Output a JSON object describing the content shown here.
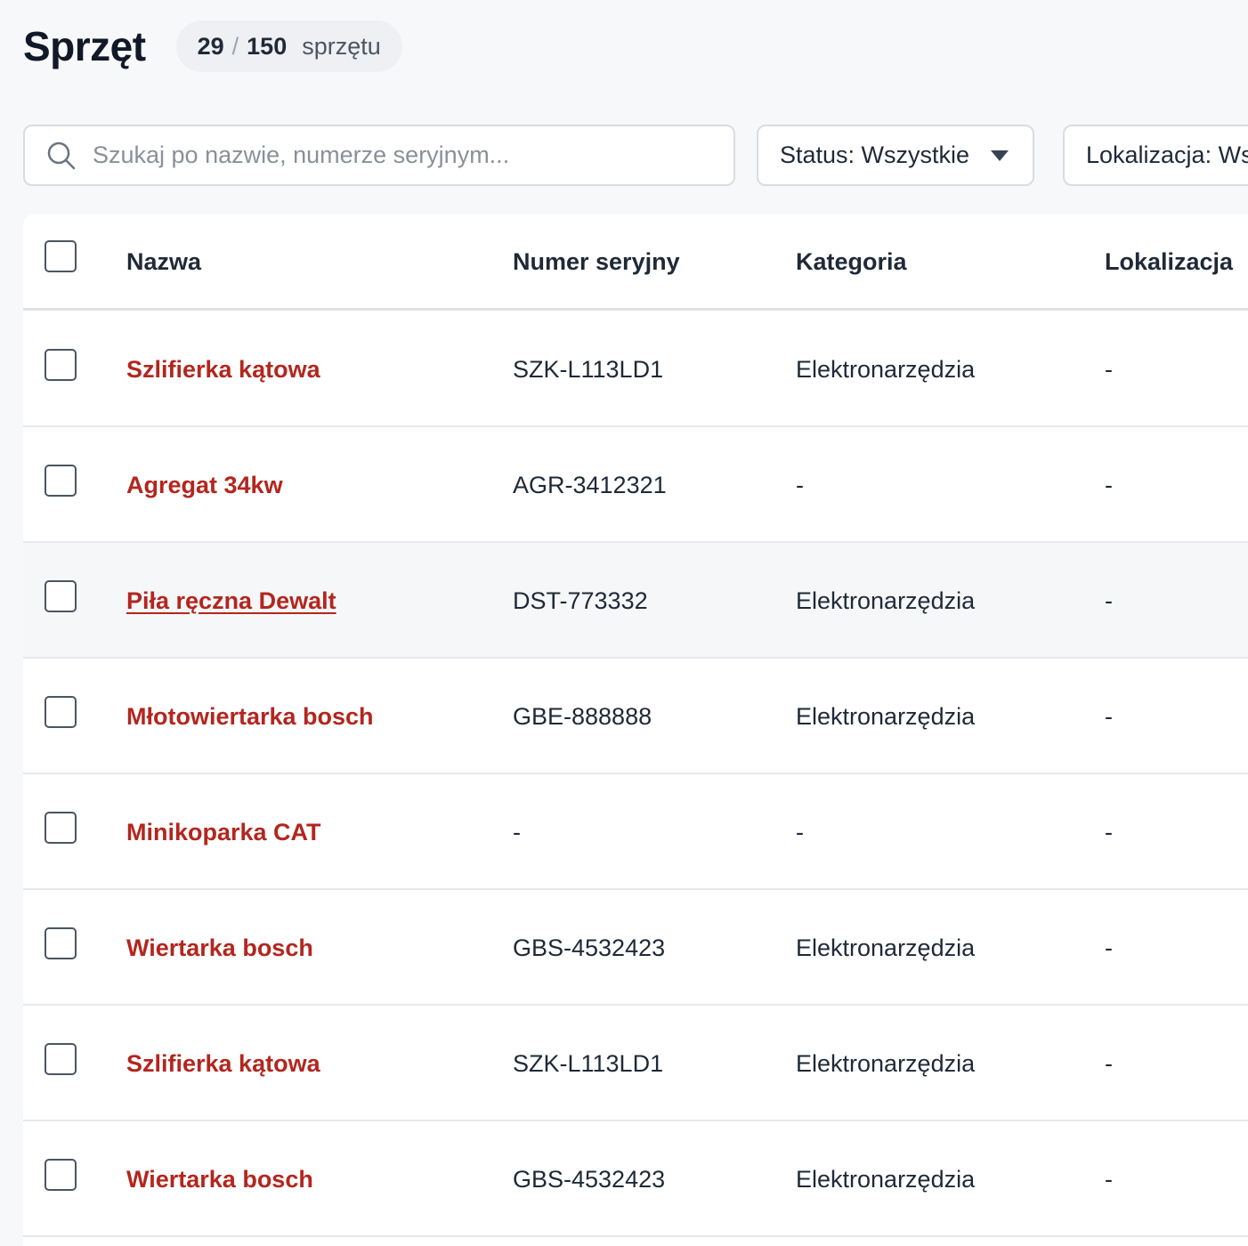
{
  "header": {
    "title": "Sprzęt",
    "count_current": "29",
    "count_separator": "/",
    "count_total": "150",
    "count_unit": "sprzętu"
  },
  "filters": {
    "search_placeholder": "Szukaj po nazwie, numerze seryjnym...",
    "search_value": "",
    "status_label": "Status: Wszystkie",
    "location_label": "Lokalizacja: Wszystkie"
  },
  "table": {
    "columns": [
      "Nazwa",
      "Numer seryjny",
      "Kategoria",
      "Lokalizacja"
    ],
    "rows": [
      {
        "name": "Szlifierka kątowa",
        "serial": "SZK-L113LD1",
        "category": "Elektronarzędzia",
        "location": "-"
      },
      {
        "name": "Agregat 34kw",
        "serial": "AGR-3412321",
        "category": "-",
        "location": "-"
      },
      {
        "name": "Piła ręczna Dewalt",
        "serial": "DST-773332",
        "category": "Elektronarzędzia",
        "location": "-"
      },
      {
        "name": "Młotowiertarka bosch",
        "serial": "GBE-888888",
        "category": "Elektronarzędzia",
        "location": "-"
      },
      {
        "name": "Minikoparka CAT",
        "serial": "-",
        "category": "-",
        "location": "-"
      },
      {
        "name": "Wiertarka bosch",
        "serial": "GBS-4532423",
        "category": "Elektronarzędzia",
        "location": "-"
      },
      {
        "name": "Szlifierka kątowa",
        "serial": "SZK-L113LD1",
        "category": "Elektronarzędzia",
        "location": "-"
      },
      {
        "name": "Wiertarka bosch",
        "serial": "GBS-4532423",
        "category": "Elektronarzędzia",
        "location": "-"
      }
    ]
  },
  "colors": {
    "accent": "#b3261e",
    "background": "#f7f8fa",
    "border": "#d9dce1"
  },
  "icons": {
    "search": "search-icon",
    "dropdown": "caret-down-icon",
    "checkbox": "checkbox-icon"
  }
}
